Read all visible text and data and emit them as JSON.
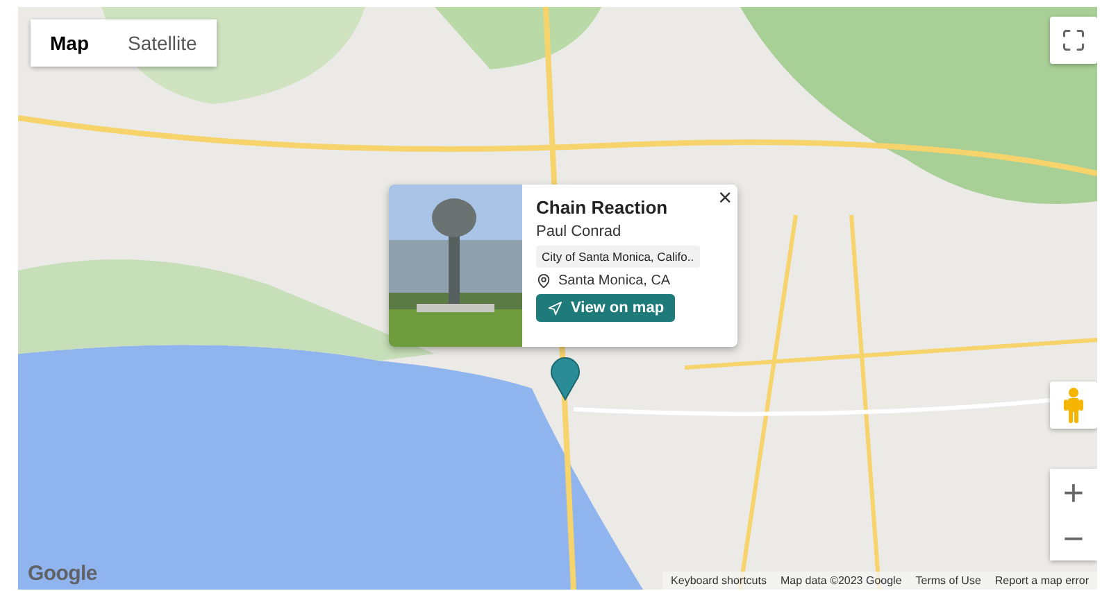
{
  "map_type_tabs": [
    {
      "label": "Map",
      "selected": true
    },
    {
      "label": "Satellite",
      "selected": false
    }
  ],
  "popup": {
    "title": "Chain Reaction",
    "artist": "Paul Conrad",
    "tag": "City of Santa Monica, Califo..",
    "location": "Santa Monica, CA",
    "button": "View on map",
    "close": "×"
  },
  "zoom": {
    "in": "+",
    "out": "−"
  },
  "logo": "Google",
  "footer": [
    "Keyboard shortcuts",
    "Map data ©2023 Google",
    "Terms of Use",
    "Report a map error"
  ]
}
